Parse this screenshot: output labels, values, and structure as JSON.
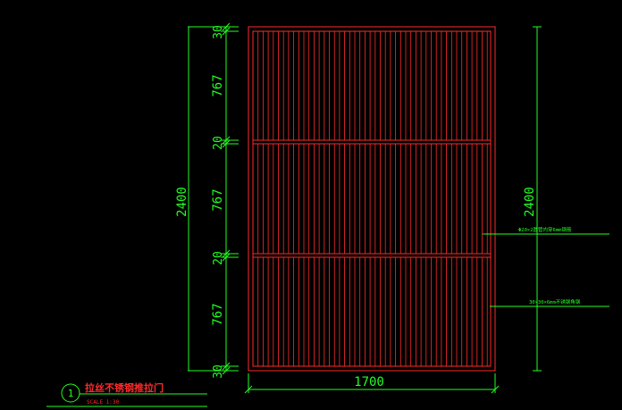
{
  "colors": {
    "background": "#000000",
    "dimension": "#22ff22",
    "frame": "#ff2a2a",
    "title_text": "#ff2a2a",
    "annotation": "#22ff22"
  },
  "dimensions": {
    "overall_width": "1700",
    "overall_height_left": "2400",
    "overall_height_right": "2400",
    "left_chain": [
      "30",
      "767",
      "20",
      "767",
      "20",
      "767",
      "30"
    ]
  },
  "annotations": [
    {
      "text": "Φ20×2圆管内穿6mm钢筋"
    },
    {
      "text": "30×30×6mm不锈钢角钢"
    }
  ],
  "title_block": {
    "number": "1",
    "title": "拉丝不锈钢推拉门",
    "scale": "SCALE  1:30"
  }
}
